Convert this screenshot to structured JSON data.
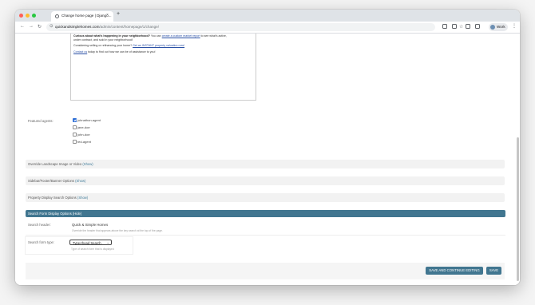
{
  "browser": {
    "tab_title": "Change home page | Django...",
    "tab_close": "×",
    "new_tab": "+",
    "url_host": "quickandsimplehomes.com",
    "url_path": "/admin/content/homepage/1/change/",
    "profile_label": "Work",
    "icons": {
      "back": "←",
      "forward": "→",
      "reload": "↻",
      "site_info": "⊙",
      "star": "☆",
      "menu": "⋮"
    }
  },
  "richtext": {
    "line1_bold": "Curious about what's happening in your neighborhood?",
    "line1_text": " You can ",
    "line1_link": "create a custom market report",
    "line1_tail": " to see what's active,",
    "line2": "under contract, and sold in your neighborhood!",
    "line3_text": "Considering selling or refinancing your home? ",
    "line3_link": "Get an INSTANT property valuation now!",
    "line4_link": "Contact us",
    "line4_text": " today to find out how we can be of assistance to you!"
  },
  "featured_agents": {
    "label": "Featured agents:",
    "agents": [
      {
        "name": "johnathon-agent",
        "checked": true
      },
      {
        "name": "jane-doe",
        "checked": false
      },
      {
        "name": "john-doe",
        "checked": false
      },
      {
        "name": "ted-agent",
        "checked": false
      }
    ]
  },
  "fieldsets": {
    "landscape": {
      "title": "Override Landscape Image or Video ",
      "toggle": "(Show)"
    },
    "sidebar": {
      "title": "Sidebar/Footer/Banner Options ",
      "toggle": "(Show)"
    },
    "property_display": {
      "title": "Property Display Search Options ",
      "toggle": "(Show)"
    }
  },
  "search_form_section": {
    "title": "Search Form Display Options ",
    "toggle": "(Hide)",
    "search_header_label": "Search header:",
    "search_header_value": "Quick & Simple Homes",
    "search_header_help": "Override the header that appears above the key search at the top of the page.",
    "search_form_type_label": "Search form type:",
    "search_form_type_value": "TypeAhead Search",
    "search_form_type_help": "Type of search form that is displayed"
  },
  "submit": {
    "save_continue": "SAVE AND CONTINUE EDITING",
    "save": "SAVE"
  },
  "colors": {
    "admin_header": "#417690",
    "checkbox_checked": "#2f6fd6"
  }
}
